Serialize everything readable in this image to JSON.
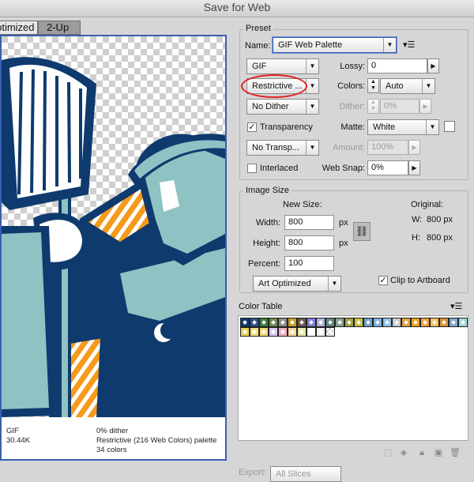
{
  "window": {
    "title": "Save for Web"
  },
  "tabs": [
    {
      "label": "Optimized",
      "active": true
    },
    {
      "label": "2-Up",
      "active": false
    }
  ],
  "preview_info": {
    "format": "GIF",
    "size": "30.44K",
    "dither": "0% dither",
    "palette": "Restrictive (216 Web Colors) palette",
    "colors": "34 colors"
  },
  "preset": {
    "title": "Preset",
    "name_label": "Name:",
    "name_value": "GIF Web Palette",
    "format_value": "GIF",
    "lossy_label": "Lossy:",
    "lossy_value": "0",
    "reduction_value": "Restrictive ...",
    "colors_label": "Colors:",
    "colors_value": "Auto",
    "dither_algo_value": "No Dither",
    "dither_label": "Dither:",
    "dither_value": "0%",
    "transparency_label": "Transparency",
    "transparency_checked": true,
    "matte_label": "Matte:",
    "matte_value": "White",
    "transp_dither_value": "No Transp...",
    "amount_label": "Amount:",
    "amount_value": "100%",
    "interlaced_label": "Interlaced",
    "interlaced_checked": false,
    "websnap_label": "Web Snap:",
    "websnap_value": "0%"
  },
  "image_size": {
    "title": "Image Size",
    "new_size_label": "New Size:",
    "original_label": "Original:",
    "width_label": "Width:",
    "width_value": "800",
    "height_label": "Height:",
    "height_value": "800",
    "unit": "px",
    "percent_label": "Percent:",
    "percent_value": "100",
    "orig_w_label": "W:",
    "orig_w_value": "800 px",
    "orig_h_label": "H:",
    "orig_h_value": "800 px",
    "quality_value": "Art Optimized",
    "clip_label": "Clip to Artboard",
    "clip_checked": true
  },
  "color_table": {
    "title": "Color Table",
    "swatches": [
      "#0a3a72",
      "#2c4f8a",
      "#3a7a3a",
      "#6a8a4a",
      "#8a8a8a",
      "#c8a020",
      "#6a5a4a",
      "#7d7dd8",
      "#b0b0d8",
      "#5a8a7a",
      "#8aa090",
      "#a0a040",
      "#c8c040",
      "#6aa0c8",
      "#7ab0e0",
      "#90c0e8",
      "#c8c8c8",
      "#e0a040",
      "#e8a020",
      "#f0a040",
      "#f0c060",
      "#d89030",
      "#80a8d0",
      "#a0d8d8",
      "#e8d060",
      "#f0e080",
      "#f0d878",
      "#d8c8f0",
      "#f0b0c0",
      "#f8d8a0",
      "#e8e8a0",
      "#ffffff",
      "#f0f0f0",
      "#transparent"
    ]
  },
  "export": {
    "label": "Export:",
    "value": "All Slices"
  },
  "colors": {
    "navy": "#0e3a6e",
    "teal": "#8fc3c3",
    "orange": "#f59a1b",
    "white": "#ffffff",
    "highlight_ring": "#e02020"
  }
}
